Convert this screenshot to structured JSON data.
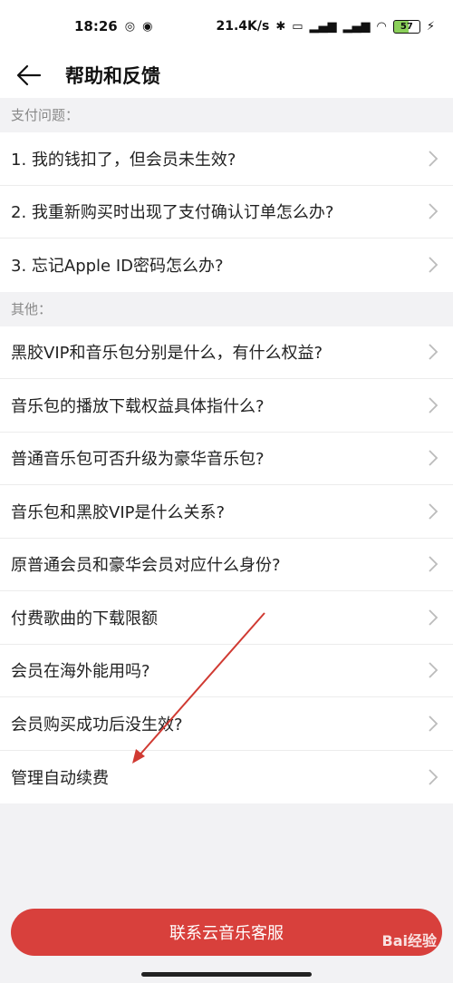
{
  "status": {
    "time": "18:26",
    "network_speed": "21.4K/s",
    "battery": "57",
    "icons": [
      "app-notification-icon",
      "app-notification-icon-2",
      "bluetooth-icon",
      "vibrate-icon",
      "signal-hd-icon",
      "signal-hd-icon-2",
      "wifi-icon",
      "battery-icon",
      "charging-icon"
    ]
  },
  "header": {
    "title": "帮助和反馈"
  },
  "sections": [
    {
      "title": "支付问题：",
      "items": [
        {
          "label": "1. 我的钱扣了，但会员未生效?"
        },
        {
          "label": "2. 我重新购买时出现了支付确认订单怎么办?"
        },
        {
          "label": "3. 忘记Apple ID密码怎么办?"
        }
      ]
    },
    {
      "title": "其他：",
      "items": [
        {
          "label": "黑胶VIP和音乐包分别是什么，有什么权益?"
        },
        {
          "label": "音乐包的播放下载权益具体指什么?"
        },
        {
          "label": "普通音乐包可否升级为豪华音乐包?"
        },
        {
          "label": "音乐包和黑胶VIP是什么关系?"
        },
        {
          "label": "原普通会员和豪华会员对应什么身份?"
        },
        {
          "label": "付费歌曲的下载限额"
        },
        {
          "label": "会员在海外能用吗?"
        },
        {
          "label": "会员购买成功后没生效?"
        },
        {
          "label": "管理自动续费"
        }
      ]
    }
  ],
  "contact_button": {
    "label": "联系云音乐客服"
  },
  "watermark": {
    "text": "Bai经验"
  },
  "colors": {
    "accent": "#d8403c",
    "annotation_arrow": "#d03a32",
    "background": "#f2f2f4"
  }
}
